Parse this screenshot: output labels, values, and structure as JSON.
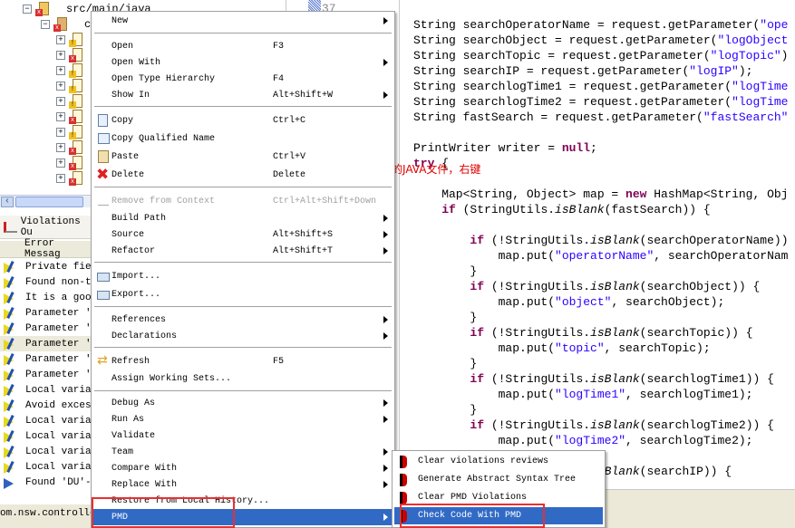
{
  "tree": {
    "root_label": "src/main/java",
    "package_label": "c",
    "files": [
      "warn",
      "err",
      "warn",
      "warn",
      "warn",
      "err",
      "warn",
      "err",
      "err",
      "err"
    ]
  },
  "violations_panel": {
    "title": "Violations Ou",
    "column_header": "Error Messag",
    "rows": [
      {
        "text": "Private fiel",
        "type": "warning"
      },
      {
        "text": "Found non-tr",
        "type": "warning"
      },
      {
        "text": "It is a good",
        "type": "warning"
      },
      {
        "text": "Parameter 'l",
        "type": "warning"
      },
      {
        "text": "Parameter 'r",
        "type": "warning"
      },
      {
        "text": "Parameter 'r",
        "type": "warning",
        "selected": true
      },
      {
        "text": "Parameter 'p",
        "type": "warning"
      },
      {
        "text": "Parameter 'r",
        "type": "warning"
      },
      {
        "text": "Local variab",
        "type": "warning"
      },
      {
        "text": "Avoid excess",
        "type": "warning"
      },
      {
        "text": "Local variab",
        "type": "warning"
      },
      {
        "text": "Local variab",
        "type": "warning"
      },
      {
        "text": "Local variab",
        "type": "warning"
      },
      {
        "text": "Local variab",
        "type": "warning"
      },
      {
        "text": "Found 'DU'-a",
        "type": "info"
      }
    ]
  },
  "status_bar": "om.nsw.controlle",
  "editor": {
    "line_number": "37",
    "lines": [
      "String searchOperatorName = request.getParameter(\"ope",
      "String searchObject = request.getParameter(\"logObject",
      "String searchTopic = request.getParameter(\"logTopic\")",
      "String searchIP = request.getParameter(\"logIP\");",
      "String searchlogTime1 = request.getParameter(\"logTime",
      "String searchlogTime2 = request.getParameter(\"logTime",
      "String fastSearch = request.getParameter(\"fastSearch\"",
      "",
      "PrintWriter writer = null;",
      "try {",
      "",
      "    Map<String, Object> map = new HashMap<String, Obj",
      "    if (StringUtils.isBlank(fastSearch)) {",
      "",
      "        if (!StringUtils.isBlank(searchOperatorName))",
      "            map.put(\"operatorName\", searchOperatorNam",
      "        }",
      "        if (!StringUtils.isBlank(searchObject)) {",
      "            map.put(\"object\", searchObject);",
      "        }",
      "        if (!StringUtils.isBlank(searchTopic)) {",
      "            map.put(\"topic\", searchTopic);",
      "        }",
      "        if (!StringUtils.isBlank(searchlogTime1)) {",
      "            map.put(\"logTime1\", searchlogTime1);",
      "        }",
      "        if (!StringUtils.isBlank(searchlogTime2)) {",
      "            map.put(\"logTime2\", searchlogTime2);",
      "        }",
      "        if (!StringUtils.isBlank(searchIP)) {"
    ]
  },
  "annotation": "选择一个检查的JAVA文件，右键",
  "context_menu": {
    "items": [
      {
        "label": "New",
        "submenu": true
      },
      {
        "sep": true
      },
      {
        "label": "Open",
        "shortcut": "F3"
      },
      {
        "label": "Open With",
        "submenu": true
      },
      {
        "label": "Open Type Hierarchy",
        "shortcut": "F4"
      },
      {
        "label": "Show In",
        "shortcut": "Alt+Shift+W",
        "submenu": true
      },
      {
        "sep": true
      },
      {
        "label": "Copy",
        "shortcut": "Ctrl+C",
        "icon": "copy-icon"
      },
      {
        "label": "Copy Qualified Name",
        "icon": "copy-qualified-name-icon"
      },
      {
        "label": "Paste",
        "shortcut": "Ctrl+V",
        "icon": "paste-icon"
      },
      {
        "label": "Delete",
        "shortcut": "Delete",
        "icon": "delete-icon"
      },
      {
        "sep": true
      },
      {
        "label": "Remove from Context",
        "shortcut": "Ctrl+Alt+Shift+Down",
        "disabled": true,
        "icon": "remove-context-icon"
      },
      {
        "label": "Build Path",
        "submenu": true
      },
      {
        "label": "Source",
        "shortcut": "Alt+Shift+S",
        "submenu": true
      },
      {
        "label": "Refactor",
        "shortcut": "Alt+Shift+T",
        "submenu": true
      },
      {
        "sep": true
      },
      {
        "label": "Import...",
        "icon": "import-icon"
      },
      {
        "label": "Export...",
        "icon": "export-icon"
      },
      {
        "sep": true
      },
      {
        "label": "References",
        "submenu": true
      },
      {
        "label": "Declarations",
        "submenu": true
      },
      {
        "sep": true
      },
      {
        "label": "Refresh",
        "shortcut": "F5",
        "icon": "refresh-icon"
      },
      {
        "label": "Assign Working Sets..."
      },
      {
        "sep": true
      },
      {
        "label": "Debug As",
        "submenu": true
      },
      {
        "label": "Run As",
        "submenu": true
      },
      {
        "label": "Validate"
      },
      {
        "label": "Team",
        "submenu": true
      },
      {
        "label": "Compare With",
        "submenu": true
      },
      {
        "label": "Replace With",
        "submenu": true
      },
      {
        "label": "Restore from Local History..."
      },
      {
        "label": "PMD",
        "submenu": true,
        "highlighted": true
      }
    ]
  },
  "pmd_submenu": {
    "items": [
      {
        "label": "Clear violations reviews"
      },
      {
        "label": "Generate Abstract Syntax Tree"
      },
      {
        "label": "Clear PMD Violations"
      },
      {
        "label": "Check Code With PMD",
        "highlighted": true
      }
    ]
  },
  "colors": {
    "highlight": "#316ac5",
    "annotation_red": "#e83030",
    "keyword": "#7f0055",
    "string": "#2a00ff"
  }
}
